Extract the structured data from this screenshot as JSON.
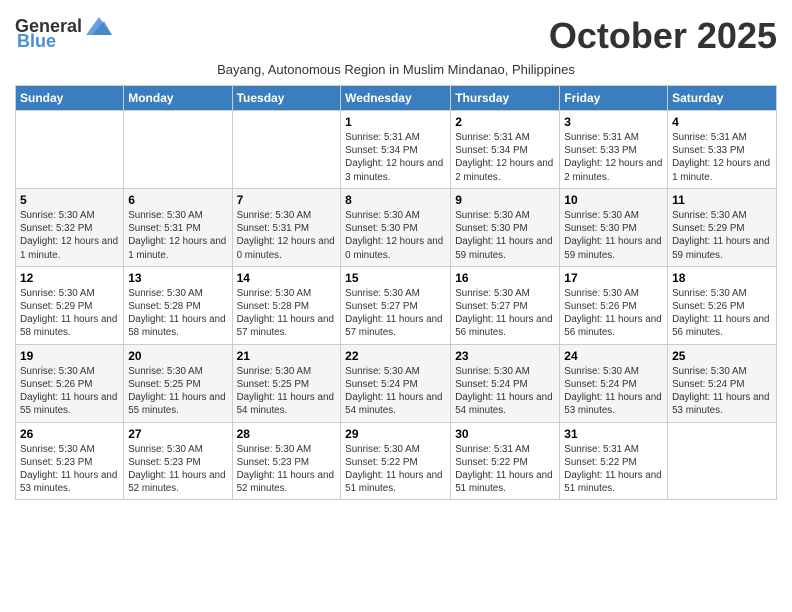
{
  "header": {
    "logo_general": "General",
    "logo_blue": "Blue",
    "month_title": "October 2025",
    "subtitle": "Bayang, Autonomous Region in Muslim Mindanao, Philippines"
  },
  "days": [
    "Sunday",
    "Monday",
    "Tuesday",
    "Wednesday",
    "Thursday",
    "Friday",
    "Saturday"
  ],
  "weeks": [
    [
      {
        "date": "",
        "info": ""
      },
      {
        "date": "",
        "info": ""
      },
      {
        "date": "",
        "info": ""
      },
      {
        "date": "1",
        "info": "Sunrise: 5:31 AM\nSunset: 5:34 PM\nDaylight: 12 hours and 3 minutes."
      },
      {
        "date": "2",
        "info": "Sunrise: 5:31 AM\nSunset: 5:34 PM\nDaylight: 12 hours and 2 minutes."
      },
      {
        "date": "3",
        "info": "Sunrise: 5:31 AM\nSunset: 5:33 PM\nDaylight: 12 hours and 2 minutes."
      },
      {
        "date": "4",
        "info": "Sunrise: 5:31 AM\nSunset: 5:33 PM\nDaylight: 12 hours and 1 minute."
      }
    ],
    [
      {
        "date": "5",
        "info": "Sunrise: 5:30 AM\nSunset: 5:32 PM\nDaylight: 12 hours and 1 minute."
      },
      {
        "date": "6",
        "info": "Sunrise: 5:30 AM\nSunset: 5:31 PM\nDaylight: 12 hours and 1 minute."
      },
      {
        "date": "7",
        "info": "Sunrise: 5:30 AM\nSunset: 5:31 PM\nDaylight: 12 hours and 0 minutes."
      },
      {
        "date": "8",
        "info": "Sunrise: 5:30 AM\nSunset: 5:30 PM\nDaylight: 12 hours and 0 minutes."
      },
      {
        "date": "9",
        "info": "Sunrise: 5:30 AM\nSunset: 5:30 PM\nDaylight: 11 hours and 59 minutes."
      },
      {
        "date": "10",
        "info": "Sunrise: 5:30 AM\nSunset: 5:30 PM\nDaylight: 11 hours and 59 minutes."
      },
      {
        "date": "11",
        "info": "Sunrise: 5:30 AM\nSunset: 5:29 PM\nDaylight: 11 hours and 59 minutes."
      }
    ],
    [
      {
        "date": "12",
        "info": "Sunrise: 5:30 AM\nSunset: 5:29 PM\nDaylight: 11 hours and 58 minutes."
      },
      {
        "date": "13",
        "info": "Sunrise: 5:30 AM\nSunset: 5:28 PM\nDaylight: 11 hours and 58 minutes."
      },
      {
        "date": "14",
        "info": "Sunrise: 5:30 AM\nSunset: 5:28 PM\nDaylight: 11 hours and 57 minutes."
      },
      {
        "date": "15",
        "info": "Sunrise: 5:30 AM\nSunset: 5:27 PM\nDaylight: 11 hours and 57 minutes."
      },
      {
        "date": "16",
        "info": "Sunrise: 5:30 AM\nSunset: 5:27 PM\nDaylight: 11 hours and 56 minutes."
      },
      {
        "date": "17",
        "info": "Sunrise: 5:30 AM\nSunset: 5:26 PM\nDaylight: 11 hours and 56 minutes."
      },
      {
        "date": "18",
        "info": "Sunrise: 5:30 AM\nSunset: 5:26 PM\nDaylight: 11 hours and 56 minutes."
      }
    ],
    [
      {
        "date": "19",
        "info": "Sunrise: 5:30 AM\nSunset: 5:26 PM\nDaylight: 11 hours and 55 minutes."
      },
      {
        "date": "20",
        "info": "Sunrise: 5:30 AM\nSunset: 5:25 PM\nDaylight: 11 hours and 55 minutes."
      },
      {
        "date": "21",
        "info": "Sunrise: 5:30 AM\nSunset: 5:25 PM\nDaylight: 11 hours and 54 minutes."
      },
      {
        "date": "22",
        "info": "Sunrise: 5:30 AM\nSunset: 5:24 PM\nDaylight: 11 hours and 54 minutes."
      },
      {
        "date": "23",
        "info": "Sunrise: 5:30 AM\nSunset: 5:24 PM\nDaylight: 11 hours and 54 minutes."
      },
      {
        "date": "24",
        "info": "Sunrise: 5:30 AM\nSunset: 5:24 PM\nDaylight: 11 hours and 53 minutes."
      },
      {
        "date": "25",
        "info": "Sunrise: 5:30 AM\nSunset: 5:24 PM\nDaylight: 11 hours and 53 minutes."
      }
    ],
    [
      {
        "date": "26",
        "info": "Sunrise: 5:30 AM\nSunset: 5:23 PM\nDaylight: 11 hours and 53 minutes."
      },
      {
        "date": "27",
        "info": "Sunrise: 5:30 AM\nSunset: 5:23 PM\nDaylight: 11 hours and 52 minutes."
      },
      {
        "date": "28",
        "info": "Sunrise: 5:30 AM\nSunset: 5:23 PM\nDaylight: 11 hours and 52 minutes."
      },
      {
        "date": "29",
        "info": "Sunrise: 5:30 AM\nSunset: 5:22 PM\nDaylight: 11 hours and 51 minutes."
      },
      {
        "date": "30",
        "info": "Sunrise: 5:31 AM\nSunset: 5:22 PM\nDaylight: 11 hours and 51 minutes."
      },
      {
        "date": "31",
        "info": "Sunrise: 5:31 AM\nSunset: 5:22 PM\nDaylight: 11 hours and 51 minutes."
      },
      {
        "date": "",
        "info": ""
      }
    ]
  ]
}
